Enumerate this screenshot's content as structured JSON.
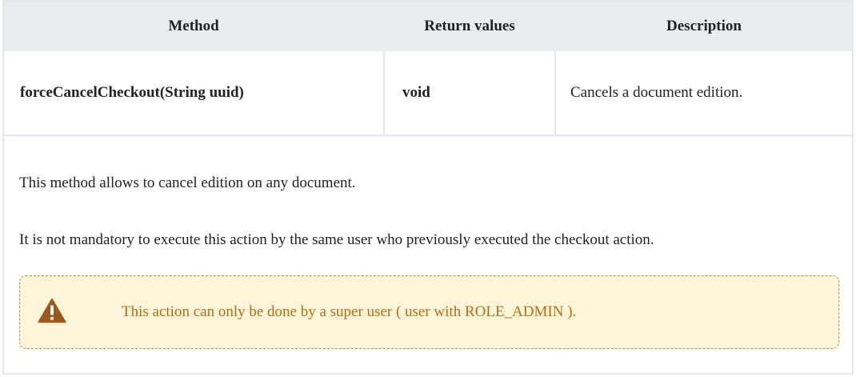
{
  "table": {
    "headers": [
      "Method",
      "Return values",
      "Description"
    ],
    "rows": [
      {
        "method": "forceCancelCheckout(String uuid)",
        "return_value": "void",
        "description": "Cancels a document edition."
      }
    ]
  },
  "notes": {
    "paragraphs": [
      "This method allows to cancel edition on any document.",
      "It is not mandatory to execute this action by the same user who previously executed the checkout action."
    ],
    "warning": {
      "icon": "warning-triangle-icon",
      "text": "This action can only be done by a super user ( user with ROLE_ADMIN ).",
      "text_color": "#b26f12",
      "background": "#fcf5d9",
      "border_color": "#b9904a",
      "icon_color": "#9a5a1e"
    }
  }
}
